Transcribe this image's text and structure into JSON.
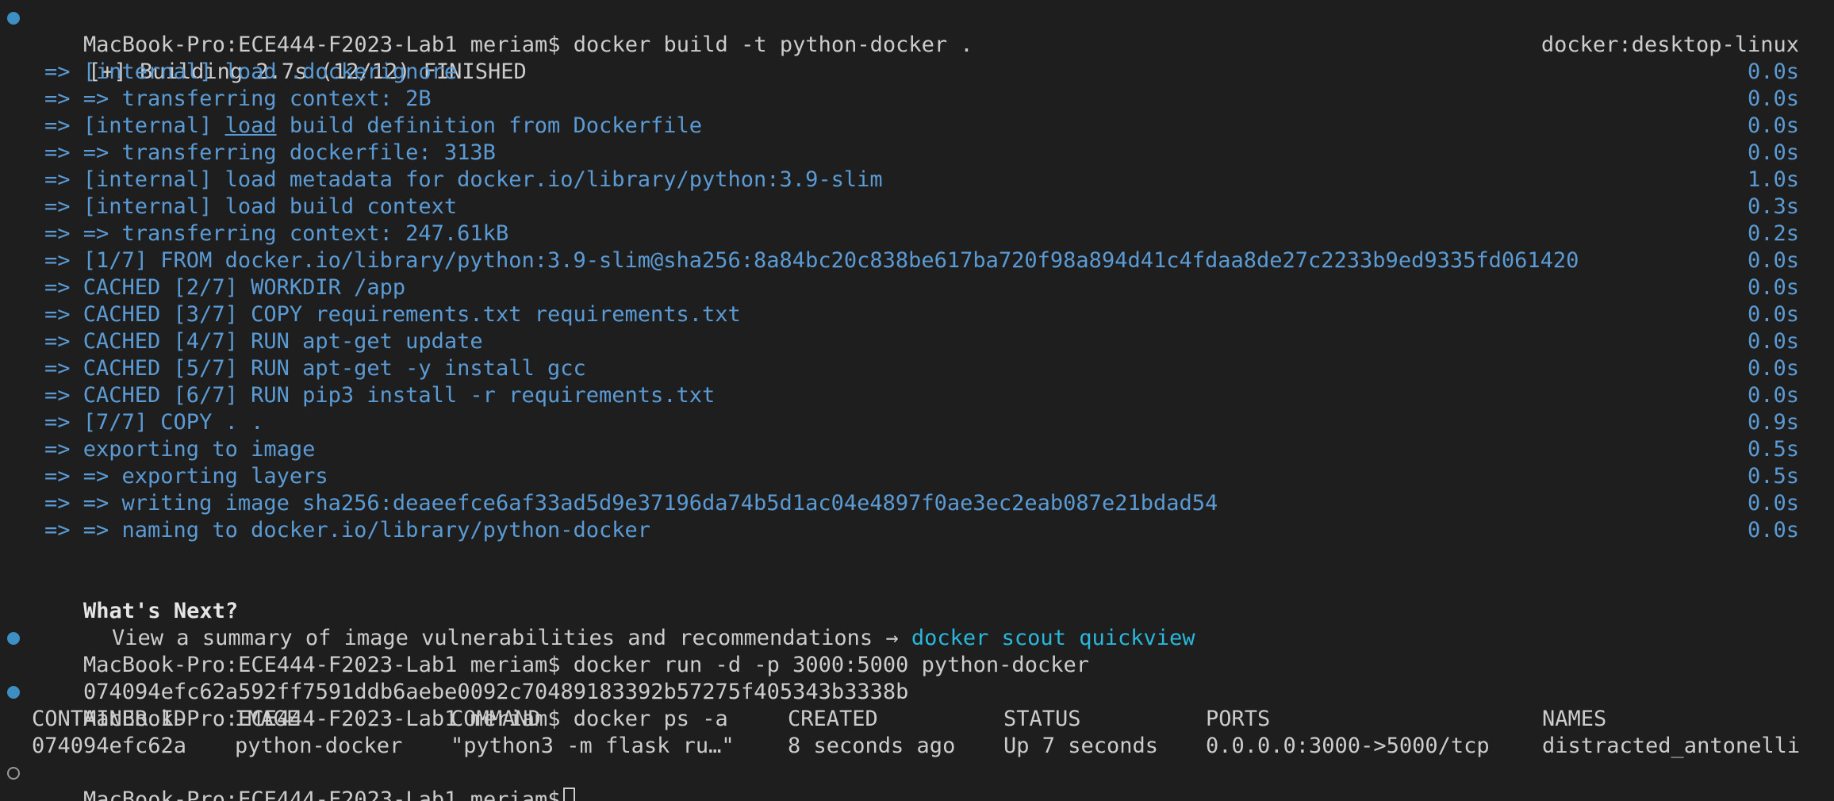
{
  "prompt": "MacBook-Pro:ECE444-F2023-Lab1 meriam$",
  "commands": {
    "build": "docker build -t python-docker .",
    "run": "docker run -d -p 3000:5000 python-docker",
    "ps": "docker ps -a"
  },
  "build": {
    "header": "[+] Building 2.7s (12/12) FINISHED",
    "context": "docker:desktop-linux",
    "steps": [
      {
        "text": "=> [internal] load .dockerignore",
        "time": "0.0s"
      },
      {
        "text": "=> => transferring context: 2B",
        "time": "0.0s"
      },
      {
        "pre": "=> [internal] ",
        "underlined": "load",
        "post": " build definition from Dockerfile",
        "time": "0.0s"
      },
      {
        "text": "=> => transferring dockerfile: 313B",
        "time": "0.0s"
      },
      {
        "text": "=> [internal] load metadata for docker.io/library/python:3.9-slim",
        "time": "1.0s"
      },
      {
        "text": "=> [internal] load build context",
        "time": "0.3s"
      },
      {
        "text": "=> => transferring context: 247.61kB",
        "time": "0.2s"
      },
      {
        "text": "=> [1/7] FROM docker.io/library/python:3.9-slim@sha256:8a84bc20c838be617ba720f98a894d41c4fdaa8de27c2233b9ed9335fd061420",
        "time": "0.0s"
      },
      {
        "text": "=> CACHED [2/7] WORKDIR /app",
        "time": "0.0s"
      },
      {
        "text": "=> CACHED [3/7] COPY requirements.txt requirements.txt",
        "time": "0.0s"
      },
      {
        "text": "=> CACHED [4/7] RUN apt-get update",
        "time": "0.0s"
      },
      {
        "text": "=> CACHED [5/7] RUN apt-get -y install gcc",
        "time": "0.0s"
      },
      {
        "text": "=> CACHED [6/7] RUN pip3 install -r requirements.txt",
        "time": "0.0s"
      },
      {
        "text": "=> [7/7] COPY . .",
        "time": "0.9s"
      },
      {
        "text": "=> exporting to image",
        "time": "0.5s"
      },
      {
        "text": "=> => exporting layers",
        "time": "0.5s"
      },
      {
        "text": "=> => writing image sha256:deaeefce6af33ad5d9e37196da74b5d1ac04e4897f0ae3ec2eab087e21bdad54",
        "time": "0.0s"
      },
      {
        "text": "=> => naming to docker.io/library/python-docker",
        "time": "0.0s"
      }
    ]
  },
  "whats_next": {
    "title": "What's Next?",
    "text": "View a summary of image vulnerabilities and recommendations → ",
    "link": "docker scout quickview"
  },
  "run_output": "074094efc62a592ff7591ddb6aebe0092c70489183392b57275f405343b3338b",
  "ps_table": {
    "headers": [
      "CONTAINER ID",
      "IMAGE",
      "COMMAND",
      "CREATED",
      "STATUS",
      "PORTS",
      "NAMES"
    ],
    "row": [
      "074094efc62a",
      "python-docker",
      "\"python3 -m flask ru…\"",
      "8 seconds ago",
      "Up 7 seconds",
      "0.0.0.0:3000->5000/tcp",
      "distracted_antonelli"
    ]
  },
  "colors": {
    "background": "#1e1e1e",
    "text": "#cccccc",
    "build_step": "#5b9bd5",
    "link": "#29b8db",
    "status_dot": "#3d8ec3"
  }
}
